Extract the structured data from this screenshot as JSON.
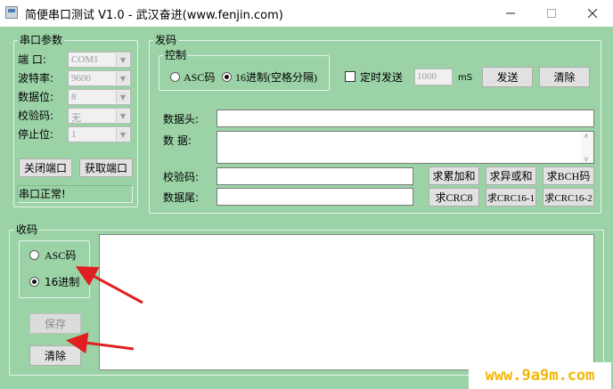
{
  "window": {
    "title": "简便串口测试 V1.0 - 武汉奋进(www.fenjin.com)"
  },
  "serial_params": {
    "group_label": "串口参数",
    "port_label": "端    口:",
    "port_value": "COM1",
    "baud_label": "波特率:",
    "baud_value": "9600",
    "databits_label": "数据位:",
    "databits_value": "8",
    "parity_label": "校验码:",
    "parity_value": "无",
    "stopbits_label": "停止位:",
    "stopbits_value": "1",
    "close_port_label": "关闭端口",
    "get_port_label": "获取端口",
    "status": "串口正常!"
  },
  "send": {
    "group_label": "发码",
    "control": {
      "group_label": "控制",
      "asc_label": "ASC码",
      "hex_label": "16进制(空格分隔)",
      "timed_label": "定时发送",
      "interval_value": "1000",
      "unit": "mS",
      "send_label": "发送",
      "clear_label": "清除"
    },
    "header_label": "数据头:",
    "data_label": "数    据:",
    "checksum_label": "校验码:",
    "tail_label": "数据尾:",
    "calc_buttons": [
      "求累加和",
      "求异或和",
      "求BCH码",
      "求CRC8",
      "求CRC16-1",
      "求CRC16-2"
    ]
  },
  "receive": {
    "group_label": "收码",
    "asc_label": "ASC码",
    "hex_label": "16进制",
    "save_label": "保存",
    "clear_label": "清除"
  },
  "colors": {
    "background": "#9bd2a6",
    "annotation_arrow": "#e02020",
    "watermark": "#f2b705"
  },
  "watermark": "www.9a9m.com"
}
